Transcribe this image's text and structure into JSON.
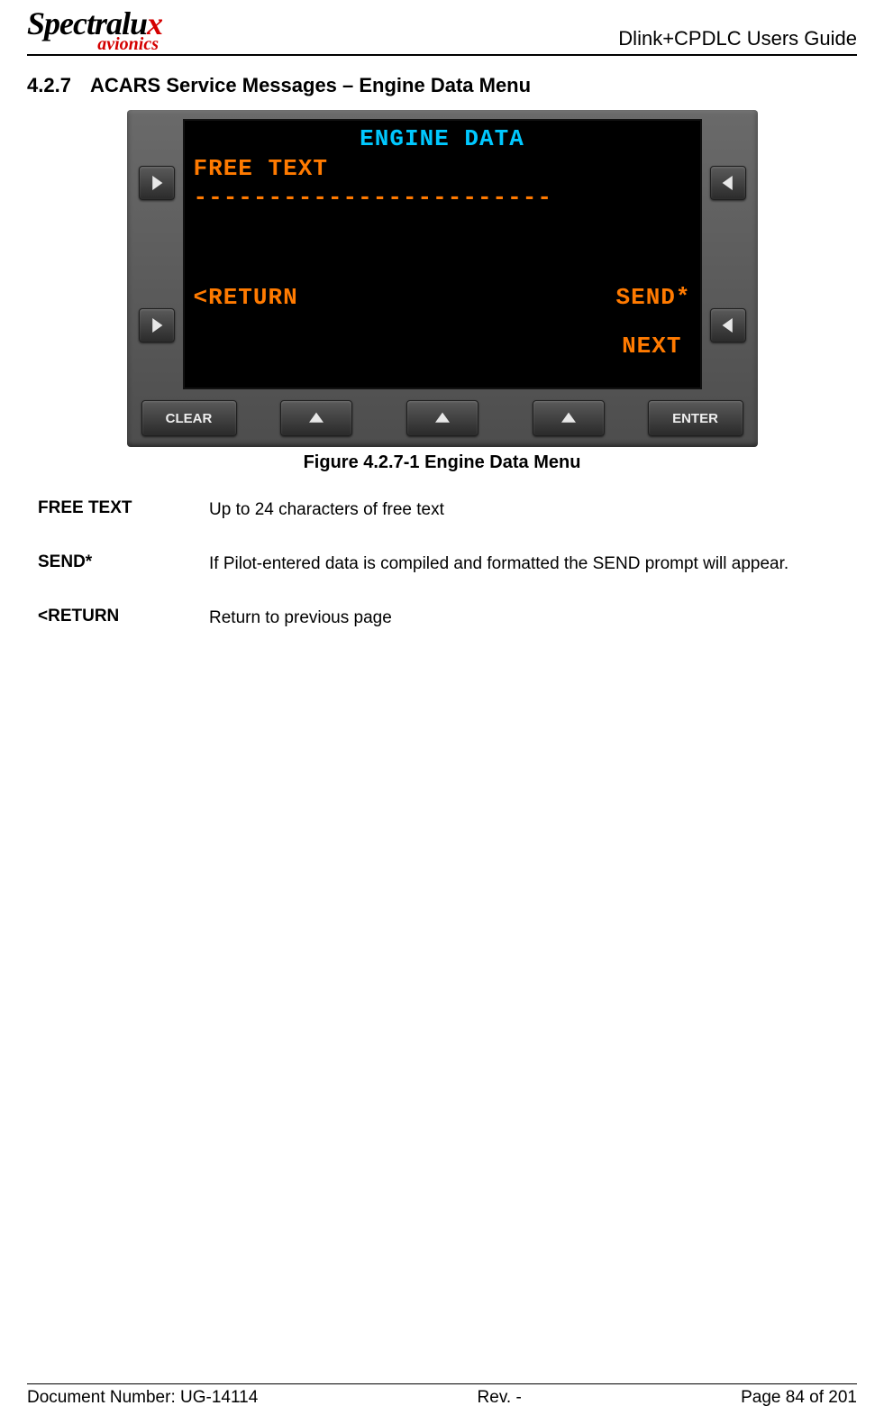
{
  "header": {
    "logo_brand_a": "Spectra",
    "logo_brand_b": "lu",
    "logo_brand_c": "x",
    "logo_sub": "avionics",
    "doc_title": "Dlink+CPDLC Users Guide"
  },
  "section": {
    "number": "4.2.7",
    "title": "ACARS Service Messages – Engine Data Menu"
  },
  "screen": {
    "title": "ENGINE DATA",
    "label1": "FREE TEXT",
    "dashes": "------------------------",
    "return": "<RETURN",
    "send": "SEND*",
    "next": "NEXT"
  },
  "buttons": {
    "clear": "CLEAR",
    "enter": "ENTER"
  },
  "figure_caption": "Figure 4.2.7-1 Engine Data Menu",
  "definitions": [
    {
      "term": "FREE TEXT",
      "body": "Up to 24 characters of free text"
    },
    {
      "term": "SEND*",
      "body": "If Pilot-entered data is compiled and formatted the SEND prompt will appear."
    },
    {
      "term": "<RETURN",
      "body": "Return to previous page"
    }
  ],
  "footer": {
    "doc_number_label": "Document Number:  UG-14114",
    "rev": "Rev. -",
    "page": "Page 84 of 201"
  }
}
